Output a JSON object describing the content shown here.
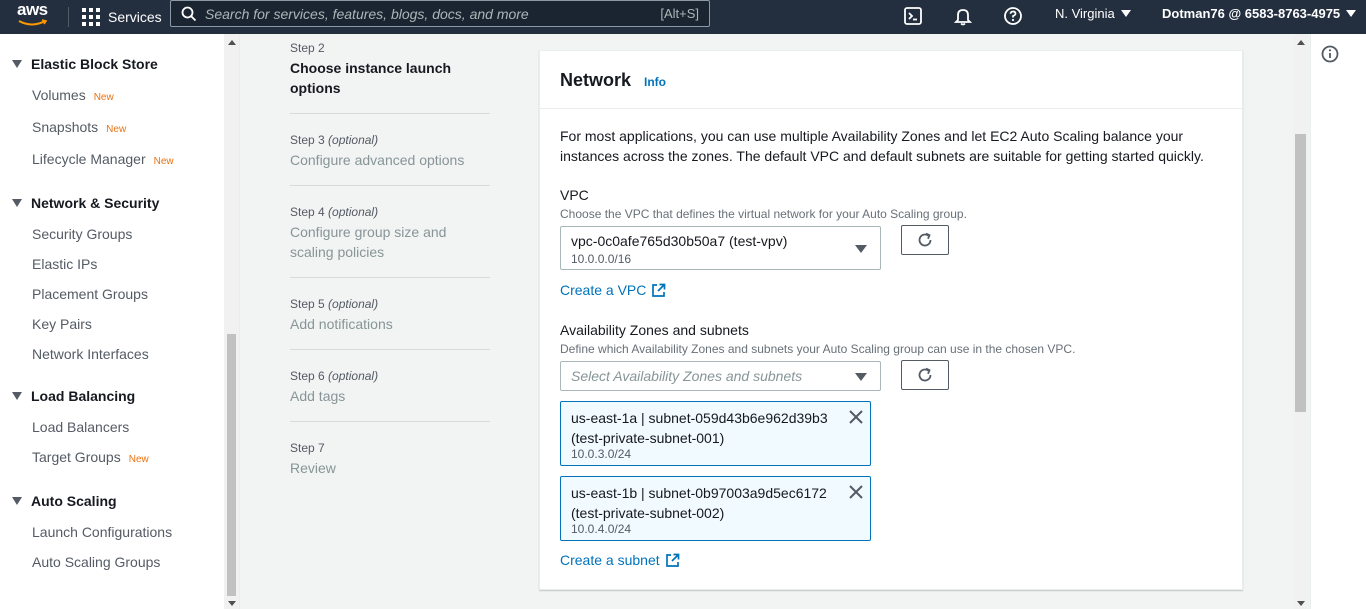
{
  "topnav": {
    "logo_text": "aws",
    "services_label": "Services",
    "search_placeholder": "Search for services, features, blogs, docs, and more",
    "search_shortcut": "[Alt+S]",
    "region": "N. Virginia",
    "account": "Dotman76 @ 6583-8763-4975",
    "icons": [
      "cloudshell-icon",
      "bell-icon",
      "help-icon"
    ],
    "bg_color": "#232f3e"
  },
  "sidebar": {
    "sections": [
      {
        "title": "Elastic Block Store",
        "items": [
          {
            "label": "Volumes",
            "badge": "New"
          },
          {
            "label": "Snapshots",
            "badge": "New"
          },
          {
            "label": "Lifecycle Manager",
            "badge": "New"
          }
        ]
      },
      {
        "title": "Network & Security",
        "items": [
          {
            "label": "Security Groups"
          },
          {
            "label": "Elastic IPs"
          },
          {
            "label": "Placement Groups"
          },
          {
            "label": "Key Pairs"
          },
          {
            "label": "Network Interfaces"
          }
        ]
      },
      {
        "title": "Load Balancing",
        "items": [
          {
            "label": "Load Balancers"
          },
          {
            "label": "Target Groups",
            "badge": "New"
          }
        ]
      },
      {
        "title": "Auto Scaling",
        "items": [
          {
            "label": "Launch Configurations"
          },
          {
            "label": "Auto Scaling Groups"
          }
        ]
      }
    ]
  },
  "steps": [
    {
      "label": "Step 2",
      "optional": "",
      "title": "Choose instance launch options",
      "active": true
    },
    {
      "label": "Step 3",
      "optional": "(optional)",
      "title": "Configure advanced options"
    },
    {
      "label": "Step 4",
      "optional": "(optional)",
      "title": "Configure group size and scaling policies"
    },
    {
      "label": "Step 5",
      "optional": "(optional)",
      "title": "Add notifications"
    },
    {
      "label": "Step 6",
      "optional": "(optional)",
      "title": "Add tags"
    },
    {
      "label": "Step 7",
      "optional": "",
      "title": "Review"
    }
  ],
  "network": {
    "title": "Network",
    "info_link": "Info",
    "description": "For most applications, you can use multiple Availability Zones and let EC2 Auto Scaling balance your instances across the zones. The default VPC and default subnets are suitable for getting started quickly.",
    "vpc": {
      "label": "VPC",
      "help": "Choose the VPC that defines the virtual network for your Auto Scaling group.",
      "selected": "vpc-0c0afe765d30b50a7 (test-vpv)",
      "cidr": "10.0.0.0/16",
      "create_link": "Create a VPC"
    },
    "az": {
      "label": "Availability Zones and subnets",
      "help": "Define which Availability Zones and subnets your Auto Scaling group can use in the chosen VPC.",
      "placeholder": "Select Availability Zones and subnets",
      "tokens": [
        {
          "line1": "us-east-1a | subnet-059d43b6e962d39b3 (test-private-subnet-001)",
          "cidr": "10.0.3.0/24"
        },
        {
          "line1": "us-east-1b | subnet-0b97003a9d5ec6172 (test-private-subnet-002)",
          "cidr": "10.0.4.0/24"
        }
      ],
      "create_link": "Create a subnet"
    }
  },
  "colors": {
    "link": "#0073bb",
    "badge_new": "#ec7211",
    "token_bg": "#f1faff"
  }
}
